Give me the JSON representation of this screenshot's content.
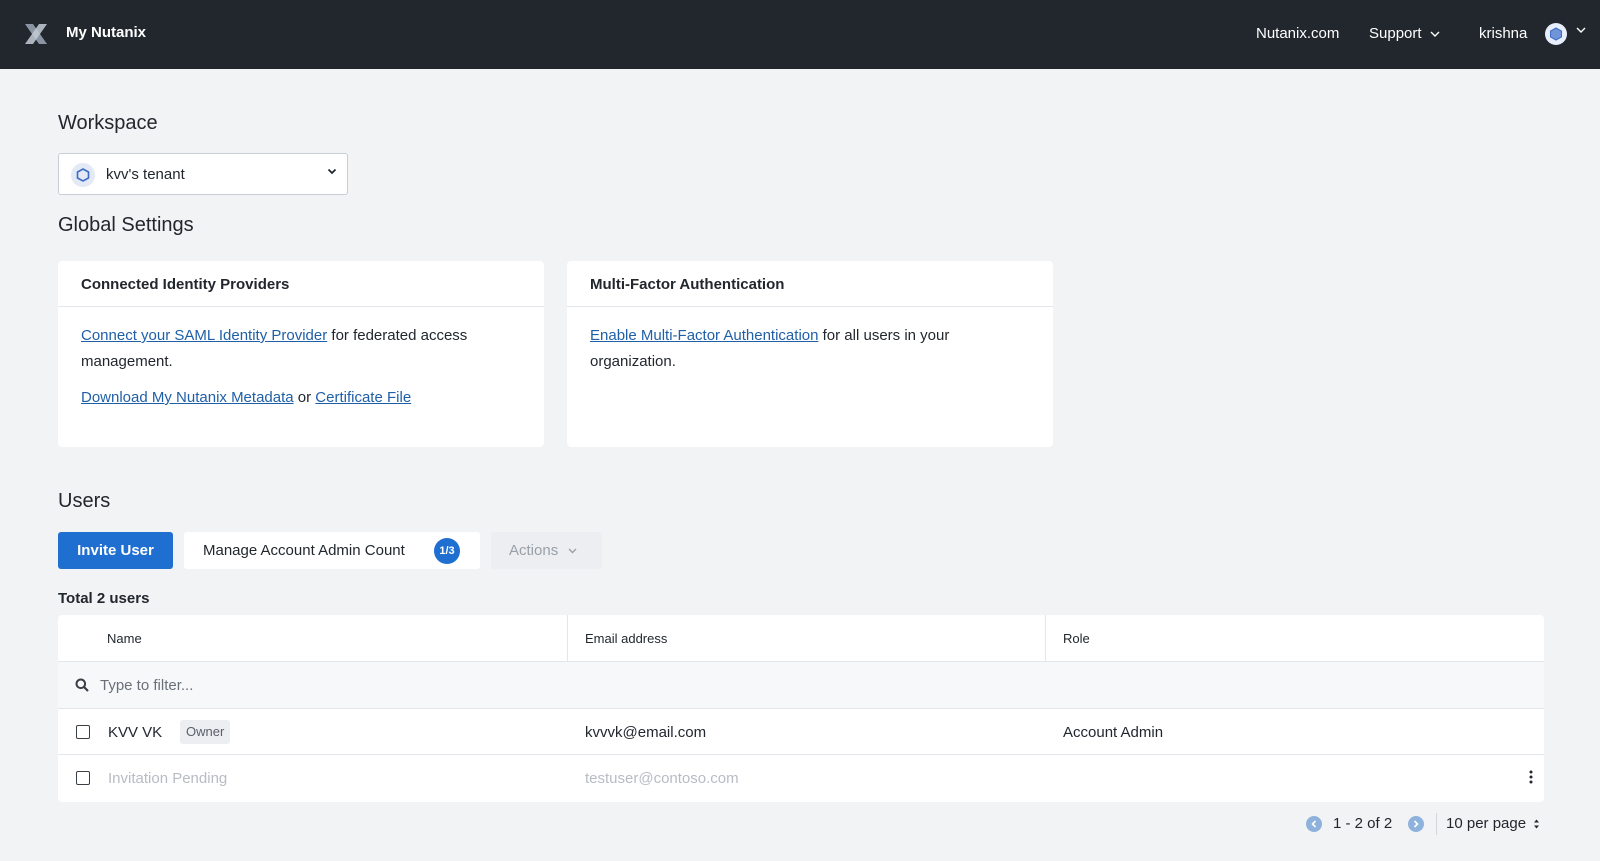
{
  "header": {
    "app_title": "My Nutanix",
    "nav_nutanix": "Nutanix.com",
    "nav_support": "Support",
    "user_name": "krishna"
  },
  "workspace": {
    "heading": "Workspace",
    "selected": "kvv's tenant"
  },
  "global_settings": {
    "heading": "Global Settings",
    "identity_card": {
      "title": "Connected Identity Providers",
      "saml_link": "Connect your SAML Identity Provider",
      "saml_text": " for federated access management.",
      "metadata_link": "Download My Nutanix Metadata",
      "or_text": " or ",
      "certificate_link": "Certificate File"
    },
    "mfa_card": {
      "title": "Multi-Factor Authentication",
      "mfa_link": "Enable Multi-Factor Authentication",
      "mfa_text": " for all users in your organization."
    }
  },
  "users": {
    "heading": "Users",
    "invite_label": "Invite User",
    "manage_label": "Manage Account Admin Count",
    "admin_count": "1/3",
    "actions_label": "Actions",
    "total_text": "Total 2 users",
    "columns": [
      "Name",
      "Email address",
      "Role"
    ],
    "filter_placeholder": "Type to filter...",
    "rows": [
      {
        "name": "KVV VK",
        "badge": "Owner",
        "email": "kvvvk@email.com",
        "role": "Account Admin"
      },
      {
        "name": "Invitation Pending",
        "badge": "",
        "email": "testuser@contoso.com",
        "role": ""
      }
    ]
  },
  "pagination": {
    "range_text": "1 - 2 of 2",
    "per_page": "10 per page"
  },
  "colors": {
    "topbar": "#22272e",
    "primary": "#1f6fd1",
    "link": "#1f5fa8",
    "page_bg": "#f2f3f5"
  },
  "icons": {
    "logo": "nutanix-x-logo",
    "support_chevron": "chevron-down-icon",
    "avatar": "hexagon-icon",
    "workspace_icon": "hexagon-icon",
    "filter": "search-icon",
    "row_menu": "kebab-menu-icon",
    "prev": "chevron-left-icon",
    "next": "chevron-right-icon"
  }
}
